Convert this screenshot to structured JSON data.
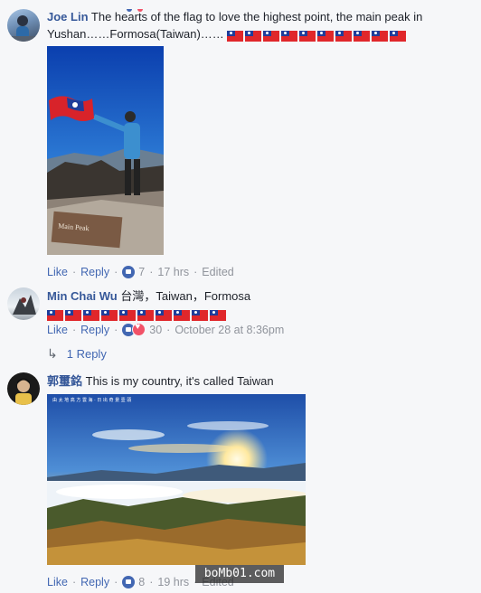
{
  "comments": [
    {
      "author": "Joe Lin",
      "text": "The hearts of the flag to love the highest point, the main peak in Yushan……Formosa(Taiwan)……",
      "flag_count": 10,
      "photo_sign": "Main Peak",
      "actions": {
        "like": "Like",
        "reply": "Reply",
        "reactions": "7",
        "time": "17 hrs",
        "edited": "Edited"
      }
    },
    {
      "author": "Min Chai Wu",
      "text": "台灣，Taiwan，Formosa",
      "flag_count": 10,
      "actions": {
        "like": "Like",
        "reply": "Reply",
        "reactions": "30",
        "time": "October 28 at 8:36pm"
      },
      "replies_label": "1 Reply"
    },
    {
      "author": "郭璽銘",
      "text": "This is my country, it's called Taiwan",
      "photo_caption": "由 太 地 高 方 雲 海 · 日 出 奇 景 壹 頭",
      "actions": {
        "like": "Like",
        "reply": "Reply",
        "reactions": "8",
        "time": "19 hrs",
        "edited": "Edited"
      }
    }
  ],
  "watermark": "boMb01.com",
  "colors": {
    "author": "#365899",
    "link": "#4267b2",
    "meta": "#90949c",
    "flag_red": "#e0272b",
    "flag_blue": "#1f3d9a"
  }
}
